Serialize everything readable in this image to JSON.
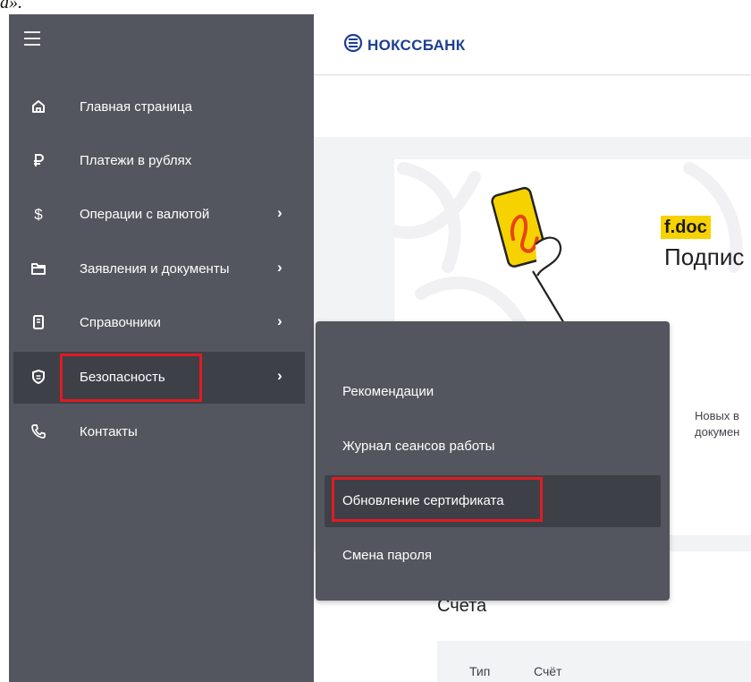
{
  "cut_text": "а».",
  "sidebar": {
    "items": [
      {
        "label": "Главная страница",
        "icon": "home-icon",
        "has_submenu": false
      },
      {
        "label": "Платежи в рублях",
        "icon": "ruble-icon",
        "has_submenu": false
      },
      {
        "label": "Операции с валютой",
        "icon": "dollar-icon",
        "has_submenu": true
      },
      {
        "label": "Заявления и документы",
        "icon": "folder-icon",
        "has_submenu": true
      },
      {
        "label": "Справочники",
        "icon": "book-icon",
        "has_submenu": true
      },
      {
        "label": "Безопасность",
        "icon": "shield-icon",
        "has_submenu": true,
        "active": true
      },
      {
        "label": "Контакты",
        "icon": "phone-icon",
        "has_submenu": false
      }
    ]
  },
  "header": {
    "logo_text": "НОКССБАНК"
  },
  "banner": {
    "tag": "f.doc",
    "title": "Подпис"
  },
  "card": {
    "line1": "Новых в",
    "line2": "докумен"
  },
  "accounts": {
    "title": "Счета",
    "columns": [
      "Тип",
      "Счёт"
    ]
  },
  "submenu": {
    "items": [
      {
        "label": "Рекомендации"
      },
      {
        "label": "Журнал сеансов работы"
      },
      {
        "label": "Обновление сертификата",
        "active": true
      },
      {
        "label": "Смена пароля"
      }
    ]
  },
  "colors": {
    "sidebar_bg": "#53565f",
    "active_bg": "#3d4047",
    "highlight": "#e01b22",
    "brand": "#1d3f8f",
    "fdoc_yellow": "#f6d300"
  }
}
